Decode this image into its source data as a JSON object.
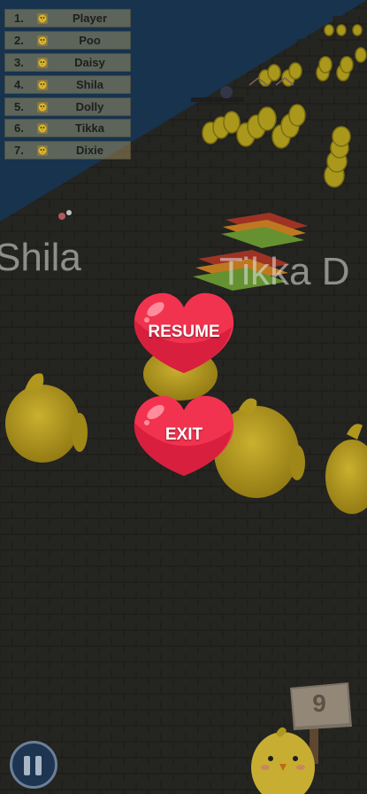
{
  "leaderboard": [
    {
      "rank": "1.",
      "name": "Player",
      "icon": "chick-face-icon"
    },
    {
      "rank": "2.",
      "name": "Poo",
      "icon": "chick-face-icon"
    },
    {
      "rank": "3.",
      "name": "Daisy",
      "icon": "chick-face-icon"
    },
    {
      "rank": "4.",
      "name": "Shila",
      "icon": "chick-face-icon"
    },
    {
      "rank": "5.",
      "name": "Dolly",
      "icon": "chick-face-icon"
    },
    {
      "rank": "6.",
      "name": "Tikka",
      "icon": "chick-face-icon"
    },
    {
      "rank": "7.",
      "name": "Dixie",
      "icon": "chick-face-icon"
    }
  ],
  "world_labels": {
    "left": "Shila",
    "right": "Tikka D"
  },
  "pause_menu": {
    "resume_label": "RESUME",
    "exit_label": "EXIT"
  },
  "signpost": {
    "value": "9"
  },
  "pause_button": {
    "icon": "pause-icon"
  },
  "colors": {
    "heart": "#f2334f",
    "water": "#1a3a58",
    "road": "#33322f",
    "chick": "#d7b72a",
    "coin": "#c7b522",
    "leaderboard_row": "#b6a46a"
  }
}
